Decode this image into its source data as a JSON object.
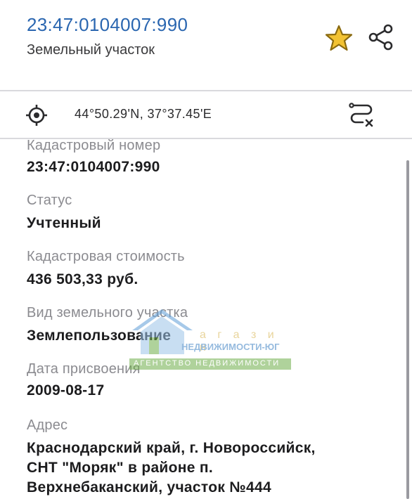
{
  "header": {
    "cadastral_number": "23:47:0104007:990",
    "object_type": "Земельный участок",
    "star_color": "#f2c233",
    "star_stroke": "#8a6a10"
  },
  "location": {
    "coordinates": "44°50.29'N, 37°37.45'E"
  },
  "fields": [
    {
      "label": "Кадастровый номер",
      "value": "23:47:0104007:990"
    },
    {
      "label": "Статус",
      "value": "Учтенный"
    },
    {
      "label": "Кадастровая стоимость",
      "value": "436 503,33 руб."
    },
    {
      "label": "Вид земельного участка",
      "value": "Землепользование"
    },
    {
      "label": "Дата присвоения",
      "value": "2009-08-17"
    },
    {
      "label": "Адрес",
      "value_lines": [
        "Краснодарский край, г. Новороссийск,",
        "СНТ \"Моряк\" в районе п.",
        "Верхнебаканский, участок №444"
      ]
    }
  ],
  "watermark": {
    "line1": "а г а з и н",
    "line2": "НЕДВИЖИМОСТИ-ЮГ",
    "line3": "АГЕНТСТВО НЕДВИЖИМОСТИ"
  },
  "colors": {
    "accent_blue": "#2a66b0",
    "label_gray": "#8b8b90",
    "divider": "#d9d9dd"
  }
}
